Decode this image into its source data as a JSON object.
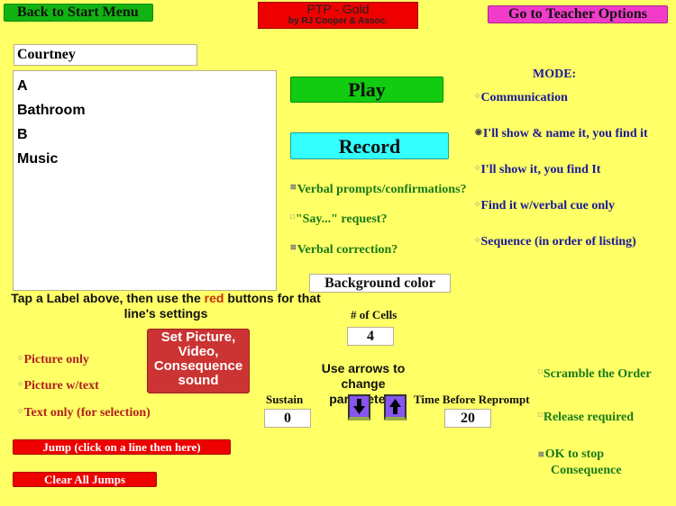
{
  "header": {
    "back_button": "Back to Start Menu",
    "app_title": "PTP - Gold",
    "app_subtitle": "by RJ Cooper & Assoc.",
    "teacher_button": "Go to Teacher Options"
  },
  "student_name": {
    "value": "Courtney"
  },
  "labels_list": {
    "items": [
      "A",
      "Bathroom",
      "B",
      "Music"
    ]
  },
  "actions": {
    "play": "Play",
    "record": "Record",
    "background_color": "Background color"
  },
  "mode": {
    "title": "MODE:",
    "options": [
      {
        "label": "Communication",
        "selected": false
      },
      {
        "label": "I'll show & name it, you find it",
        "selected": true
      },
      {
        "label": "I'll show it, you find It",
        "selected": false
      },
      {
        "label": "Find it w/verbal cue only",
        "selected": false
      },
      {
        "label": "Sequence (in order of listing)",
        "selected": false
      }
    ]
  },
  "verbal_options": [
    {
      "label": "Verbal prompts/confirmations?",
      "checked": true
    },
    {
      "label": "\"Say...\" request?",
      "checked": false
    },
    {
      "label": "Verbal correction?",
      "checked": true
    }
  ],
  "instruction": {
    "part1": "Tap a Label above, then use the ",
    "highlight": "red",
    "part2": " buttons for that line's settings"
  },
  "display_options": [
    {
      "label": "Picture only",
      "selected": false
    },
    {
      "label": "Picture w/text",
      "selected": false
    },
    {
      "label": "Text only (for selection)",
      "selected": false
    }
  ],
  "set_picture_button": [
    "Set Picture,",
    "Video,",
    "Consequence",
    "sound"
  ],
  "parameters": {
    "cells_label": "# of Cells",
    "cells_value": "4",
    "arrows_hint": [
      "Use arrows to",
      "change parameters"
    ],
    "sustain_label": "Sustain",
    "sustain_value": "0",
    "reprompt_label": "Time Before Reprompt",
    "reprompt_value": "20",
    "down_icon": "arrow-down-icon",
    "up_icon": "arrow-up-icon"
  },
  "right_options": [
    {
      "label": "Scramble the Order",
      "checked": false
    },
    {
      "label": "Release required",
      "checked": false
    },
    {
      "label": "OK to stop",
      "label2": "Consequence",
      "checked": true
    }
  ],
  "jumps": {
    "jump_button": "Jump (click on a line then here)",
    "clear_button": "Clear All Jumps"
  }
}
